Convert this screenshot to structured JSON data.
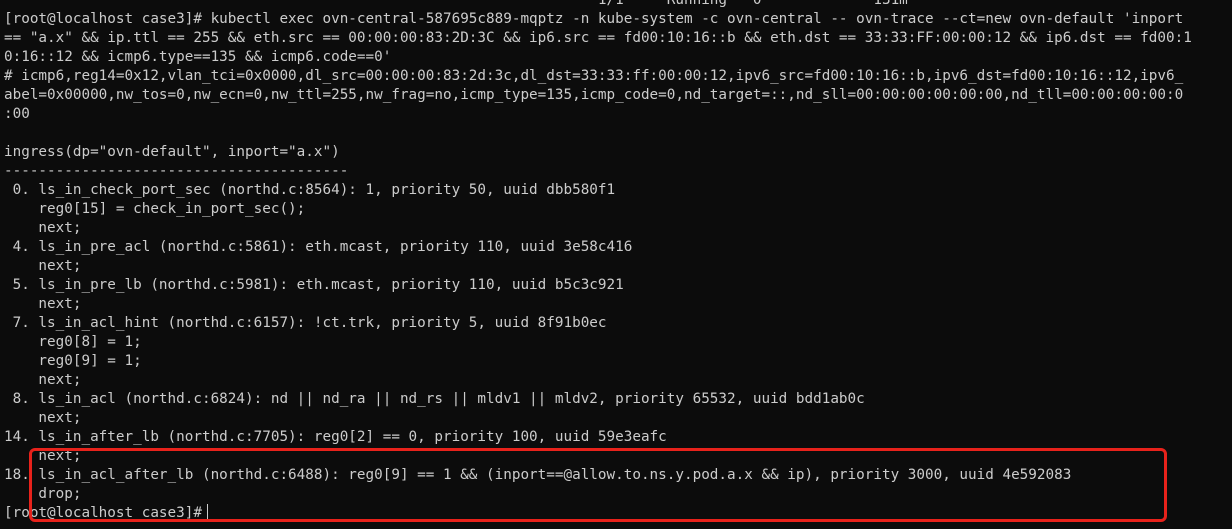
{
  "terminal": {
    "lines": [
      "                                                                     1/1     Running   0             131m",
      "[root@localhost case3]# kubectl exec ovn-central-587695c889-mqptz -n kube-system -c ovn-central -- ovn-trace --ct=new ovn-default 'inport",
      "== \"a.x\" && ip.ttl == 255 && eth.src == 00:00:00:83:2D:3C && ip6.src == fd00:10:16::b && eth.dst == 33:33:FF:00:00:12 && ip6.dst == fd00:1",
      "0:16::12 && icmp6.type==135 && icmp6.code==0'",
      "# icmp6,reg14=0x12,vlan_tci=0x0000,dl_src=00:00:00:83:2d:3c,dl_dst=33:33:ff:00:00:12,ipv6_src=fd00:10:16::b,ipv6_dst=fd00:10:16::12,ipv6_",
      "abel=0x00000,nw_tos=0,nw_ecn=0,nw_ttl=255,nw_frag=no,icmp_type=135,icmp_code=0,nd_target=::,nd_sll=00:00:00:00:00:00,nd_tll=00:00:00:00:0",
      ":00",
      "",
      "ingress(dp=\"ovn-default\", inport=\"a.x\")",
      "----------------------------------------",
      " 0. ls_in_check_port_sec (northd.c:8564): 1, priority 50, uuid dbb580f1",
      "    reg0[15] = check_in_port_sec();",
      "    next;",
      " 4. ls_in_pre_acl (northd.c:5861): eth.mcast, priority 110, uuid 3e58c416",
      "    next;",
      " 5. ls_in_pre_lb (northd.c:5981): eth.mcast, priority 110, uuid b5c3c921",
      "    next;",
      " 7. ls_in_acl_hint (northd.c:6157): !ct.trk, priority 5, uuid 8f91b0ec",
      "    reg0[8] = 1;",
      "    reg0[9] = 1;",
      "    next;",
      " 8. ls_in_acl (northd.c:6824): nd || nd_ra || nd_rs || mldv1 || mldv2, priority 65532, uuid bdd1ab0c",
      "    next;",
      "14. ls_in_after_lb (northd.c:7705): reg0[2] == 0, priority 100, uuid 59e3eafc",
      "    next;",
      "18. ls_in_acl_after_lb (northd.c:6488): reg0[9] == 1 && (inport==@allow.to.ns.y.pod.a.x && ip), priority 3000, uuid 4e592083",
      "    drop;"
    ],
    "prompt": "[root@localhost case3]#"
  },
  "colors": {
    "background": "#0c0c0c",
    "text": "#cccccc",
    "highlight_box": "#e8221b"
  }
}
